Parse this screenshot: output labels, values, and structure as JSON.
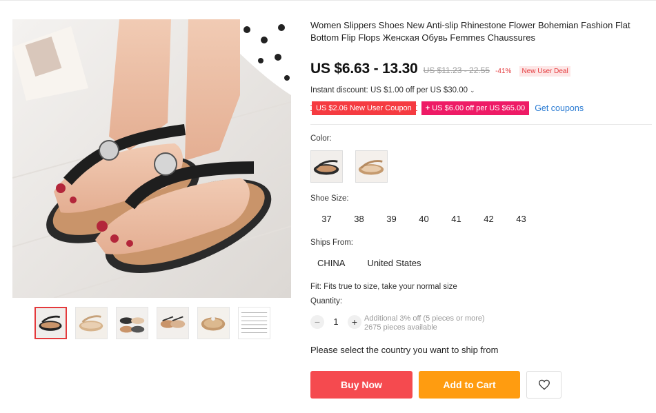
{
  "product": {
    "title": "Women Slippers Shoes New Anti-slip Rhinestone Flower Bohemian Fashion Flat Bottom Flip Flops Женская Обувь Femmes Chaussures",
    "price": "US $6.63 - 13.30",
    "original_price": "US $11.23 - 22.55",
    "discount": "-41%",
    "new_user_deal": "New User Deal"
  },
  "instant_discount": {
    "text": "Instant discount: US $1.00 off per US $30.00"
  },
  "coupons": {
    "coupon1": "US $2.06 New User Coupon",
    "coupon2": "US $6.00 off per US $65.00",
    "get_coupons": "Get coupons"
  },
  "color": {
    "label": "Color:"
  },
  "shoe_size": {
    "label": "Shoe Size:",
    "options": [
      "37",
      "38",
      "39",
      "40",
      "41",
      "42",
      "43"
    ]
  },
  "ships_from": {
    "label": "Ships From:",
    "options": [
      "CHINA",
      "United States"
    ]
  },
  "fit": "Fit: Fits true to size, take your normal size",
  "quantity": {
    "label": "Quantity:",
    "value": "1",
    "minus": "−",
    "plus": "+",
    "additional": "Additional 3% off (5 pieces or more)",
    "available": "2675 pieces available"
  },
  "select_country": "Please select the country you want to ship from",
  "actions": {
    "buy_now": "Buy Now",
    "add_to_cart": "Add to Cart"
  },
  "colors": {
    "price_red": "#e4393c",
    "buy_now": "#f54a4f",
    "add_to_cart": "#ff9c10",
    "coupon_red": "#f53b41",
    "coupon_pink": "#ee1b66",
    "link_blue": "#2a7bd3"
  },
  "icons": {
    "wishlist": "heart-icon",
    "dropdown": "chevron-down-icon"
  }
}
